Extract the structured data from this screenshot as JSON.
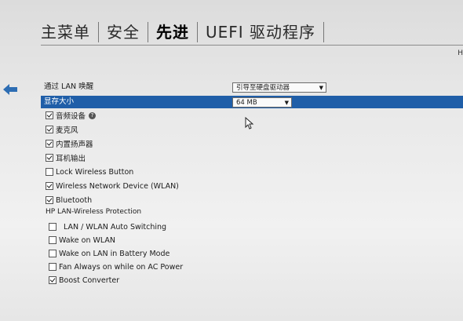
{
  "tabs": [
    "主菜单",
    "安全",
    "先进",
    "UEFI 驱动程序"
  ],
  "corner_letter": "H",
  "lan_wake": {
    "label": "通过 LAN 唤醒",
    "value": "引导至硬盘驱动器"
  },
  "video_mem": {
    "label": "显存大小",
    "value": "64 MB"
  },
  "checkboxes": [
    {
      "label": "音频设备",
      "checked": true,
      "help": "?"
    },
    {
      "label": "麦克风",
      "checked": true
    },
    {
      "label": "内置扬声器",
      "checked": true
    },
    {
      "label": "耳机输出",
      "checked": true
    },
    {
      "label": "Lock Wireless Button",
      "checked": false
    },
    {
      "label": "Wireless Network Device (WLAN)",
      "checked": true
    },
    {
      "label": "Bluetooth",
      "checked": true
    }
  ],
  "section_title": "HP LAN-Wireless Protection",
  "lan_items": [
    {
      "label": "LAN / WLAN Auto Switching",
      "checked": false
    },
    {
      "label": "Wake on WLAN",
      "checked": false
    },
    {
      "label": "Wake on LAN in Battery Mode",
      "checked": false
    },
    {
      "label": "Fan Always on while on AC Power",
      "checked": false
    },
    {
      "label": "Boost Converter",
      "checked": true
    }
  ],
  "colors": {
    "highlight": "#1f5ea8"
  }
}
